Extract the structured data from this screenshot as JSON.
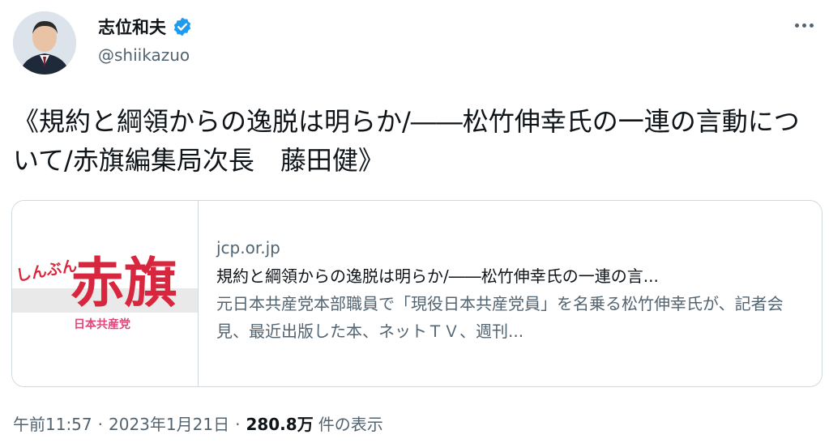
{
  "author": {
    "display_name": "志位和夫",
    "handle": "@shiikazuo",
    "verified": true
  },
  "tweet": {
    "text": "《規約と綱領からの逸脱は明らか/――松竹伸幸氏の一連の言動について/赤旗編集局次長　藤田健》"
  },
  "link_card": {
    "thumbnail_logo_small": "しんぶん",
    "thumbnail_logo_main": "赤旗",
    "thumbnail_logo_sub": "日本共産党",
    "domain": "jcp.or.jp",
    "title": "規約と綱領からの逸脱は明らか/――松竹伸幸氏の一連の言...",
    "description": "元日本共産党本部職員で「現役日本共産党員」を名乗る松竹伸幸氏が、記者会見、最近出版した本、ネットＴＶ、週刊..."
  },
  "meta": {
    "time": "午前11:57",
    "separator": "·",
    "date": "2023年1月21日",
    "views_count": "280.8万",
    "views_label": "件の表示"
  },
  "colors": {
    "verified_badge": "#1d9bf0",
    "logo_red": "#d7263d",
    "text_primary": "#0f1419",
    "text_secondary": "#536471"
  }
}
